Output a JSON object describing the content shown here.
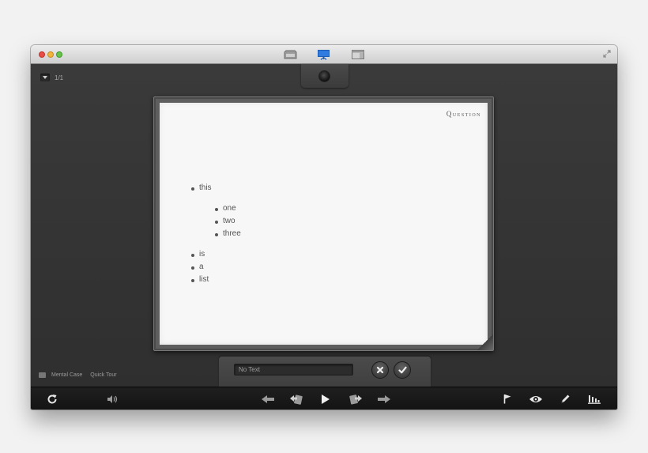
{
  "titlebar": {
    "icons": [
      "library-icon",
      "presentation-icon",
      "browse-icon",
      "fullscreen-icon"
    ]
  },
  "page_indicator": {
    "value": "1/1"
  },
  "card": {
    "kind": "Question",
    "items": [
      {
        "text": "this",
        "level": 1
      },
      {
        "text": "one",
        "level": 2
      },
      {
        "text": "two",
        "level": 2
      },
      {
        "text": "three",
        "level": 2
      },
      {
        "text": "is",
        "level": 1
      },
      {
        "text": "a",
        "level": 1
      },
      {
        "text": "list",
        "level": 1
      }
    ]
  },
  "status": {
    "deck_name": "Mental Case",
    "card_set": "Quick Tour"
  },
  "answer": {
    "placeholder": "No Text"
  },
  "toolbar": {
    "left": [
      "refresh-icon",
      "speaker-icon"
    ],
    "center": [
      "previous-icon",
      "flip-back-icon",
      "play-icon",
      "flip-forward-icon",
      "next-icon"
    ],
    "right": [
      "flag-icon",
      "eye-icon",
      "pencil-icon",
      "chart-icon"
    ]
  },
  "colors": {
    "accent": "#2f7be0",
    "board": "#5e5e5e",
    "background": "#333333"
  }
}
